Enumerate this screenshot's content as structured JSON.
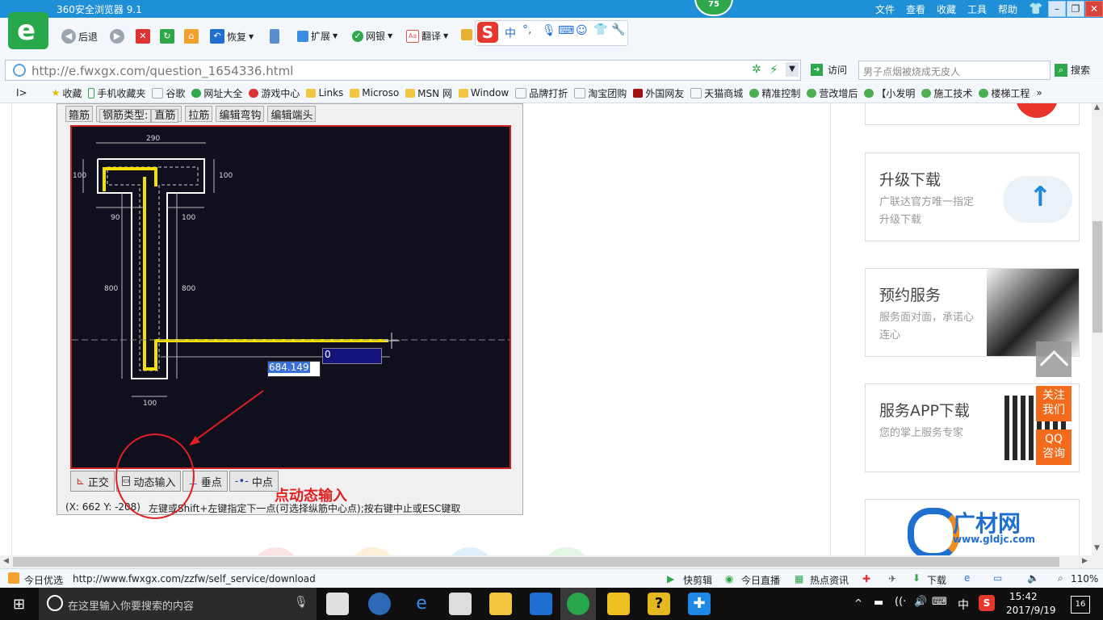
{
  "window": {
    "title": "360安全浏览器 9.1",
    "badge": "75",
    "menu": [
      "文件",
      "查看",
      "收藏",
      "工具",
      "帮助"
    ]
  },
  "toolbar": {
    "back": "后退",
    "restore": "恢复",
    "extend": "扩展",
    "netbank": "网银",
    "translate": "翻译",
    "ime_lang": "中"
  },
  "address": {
    "url": "http://e.fwxgx.com/question_1654336.html",
    "visit": "访问",
    "search_placeholder": "男子点烟被烧成无皮人",
    "search_button": "搜索"
  },
  "bookmarks": [
    "收藏",
    "手机收藏夹",
    "谷歌",
    "网址大全",
    "游戏中心",
    "Links",
    "Microso",
    "MSN 网",
    "Window",
    "品牌打折",
    "淘宝团购",
    "外国网友",
    "天猫商城",
    "精准控制",
    "营改增后",
    "【小发明",
    "施工技术",
    "楼梯工程"
  ],
  "cad": {
    "tabs": [
      "箍筋",
      "钢筋类型:",
      "直筋",
      "拉筋",
      "编辑弯钩",
      "编辑端头"
    ],
    "dims": [
      "290",
      "100",
      "100",
      "90",
      "100",
      "800",
      "800",
      "100"
    ],
    "input_length": "684.149",
    "input_angle": "0",
    "buttons": [
      "正交",
      "动态输入",
      "垂点",
      "中点"
    ],
    "coords": "(X: 662 Y: -208)",
    "status": "左键或Shift+左键指定下一点(可选择纵筋中心点);按右键中止或ESC键取"
  },
  "annotation": "点动态输入",
  "sidebar": {
    "cards": [
      {
        "title": "升级下载",
        "sub": "广联达官方唯一指定升级下载"
      },
      {
        "title": "预约服务",
        "sub": "服务面对面，承诺心连心"
      },
      {
        "title": "服务APP下载",
        "sub": "您的掌上服务专家"
      },
      {
        "title": "广材网",
        "sub": "www.gldjc.com"
      }
    ],
    "float_follow": "关注我们",
    "float_qq": "QQ咨询"
  },
  "statusbar": {
    "left": "今日优选",
    "url": "http://www.fwxgx.com/zzfw/self_service/download",
    "items": [
      "快剪辑",
      "今日直播",
      "热点资讯",
      "下载"
    ],
    "zoom": "110%"
  },
  "taskbar": {
    "search_placeholder": "在这里输入你要搜索的内容",
    "ime": "中",
    "time": "15:42",
    "date": "2017/9/19",
    "notifications": "16"
  },
  "colors": {
    "accent": "#1f8fd8",
    "brand": "#27a84a",
    "annotation": "#e02020",
    "orange": "#f26a1b"
  }
}
